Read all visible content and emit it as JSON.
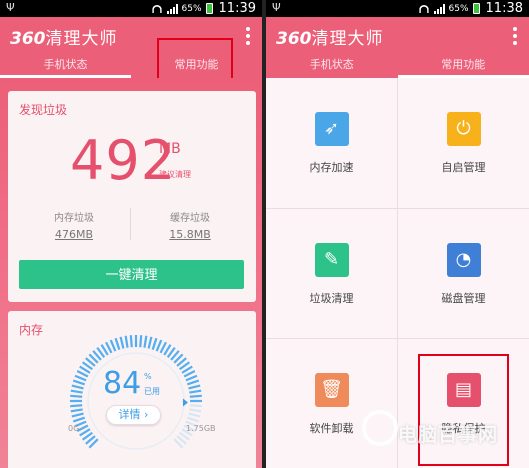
{
  "status": {
    "battery_pct": "65%",
    "time": "11:39",
    "time_right": "11:38"
  },
  "app": {
    "title_num": "360",
    "title_text": "清理大师"
  },
  "tabs": [
    "手机状态",
    "常用功能"
  ],
  "junk": {
    "title": "发现垃圾",
    "amount": "492",
    "unit": "MB",
    "suggest": "建议清理",
    "memory_label": "内存垃圾",
    "memory_value": "476MB",
    "cache_label": "缓存垃圾",
    "cache_value": "15.8MB",
    "clean_button": "一键清理"
  },
  "memory": {
    "title": "内存",
    "percent": "84",
    "pct_sign": "%",
    "used_label": "已用",
    "detail_button": "详情 ›",
    "min": "0G",
    "max": "1.75GB",
    "used_fraction": 0.84
  },
  "features": [
    {
      "name": "内存加速",
      "icon": "rocket-icon",
      "color": "#4ba6e8"
    },
    {
      "name": "自启管理",
      "icon": "power-icon",
      "color": "#f7b21b"
    },
    {
      "name": "垃圾清理",
      "icon": "broom-icon",
      "color": "#2ec28b"
    },
    {
      "name": "磁盘管理",
      "icon": "pie-chart-icon",
      "color": "#3f7fd6"
    },
    {
      "name": "软件卸载",
      "icon": "trash-icon",
      "color": "#ef8a5a"
    },
    {
      "name": "隐私保护",
      "icon": "shredder-icon",
      "color": "#e5506c"
    }
  ],
  "watermark": {
    "text": "电脑百事网"
  }
}
